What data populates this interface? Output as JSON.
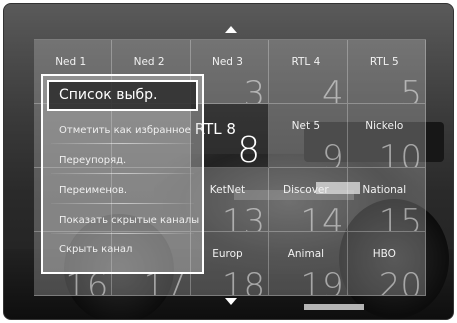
{
  "channels": [
    {
      "name": "Ned 1",
      "number": ""
    },
    {
      "name": "Ned 2",
      "number": ""
    },
    {
      "name": "Ned 3",
      "number": "3"
    },
    {
      "name": "RTL 4",
      "number": "4"
    },
    {
      "name": "RTL 5",
      "number": "5"
    },
    {
      "name": "",
      "number": ""
    },
    {
      "name": "",
      "number": ""
    },
    {
      "name": "RTL 8",
      "number": "8"
    },
    {
      "name": "Net 5",
      "number": "9"
    },
    {
      "name": "Nickelo",
      "number": "10"
    },
    {
      "name": "",
      "number": ""
    },
    {
      "name": "",
      "number": ""
    },
    {
      "name": "KetNet",
      "number": "13"
    },
    {
      "name": "Discover",
      "number": "14"
    },
    {
      "name": "National",
      "number": "15"
    },
    {
      "name": "",
      "number": "16"
    },
    {
      "name": "",
      "number": "17"
    },
    {
      "name": "Europ",
      "number": "18"
    },
    {
      "name": "Animal",
      "number": "19"
    },
    {
      "name": "HBO",
      "number": "20"
    }
  ],
  "selected_channel_index": 7,
  "menu": {
    "title": "Список выбр.",
    "items": [
      "Отметить как избранное",
      "Переупоряд.",
      "Переименов.",
      "Показать скрытые каналы",
      "Скрыть канал"
    ]
  },
  "colors": {
    "accent": "#ffffff",
    "panel": "#c8c8c8"
  }
}
